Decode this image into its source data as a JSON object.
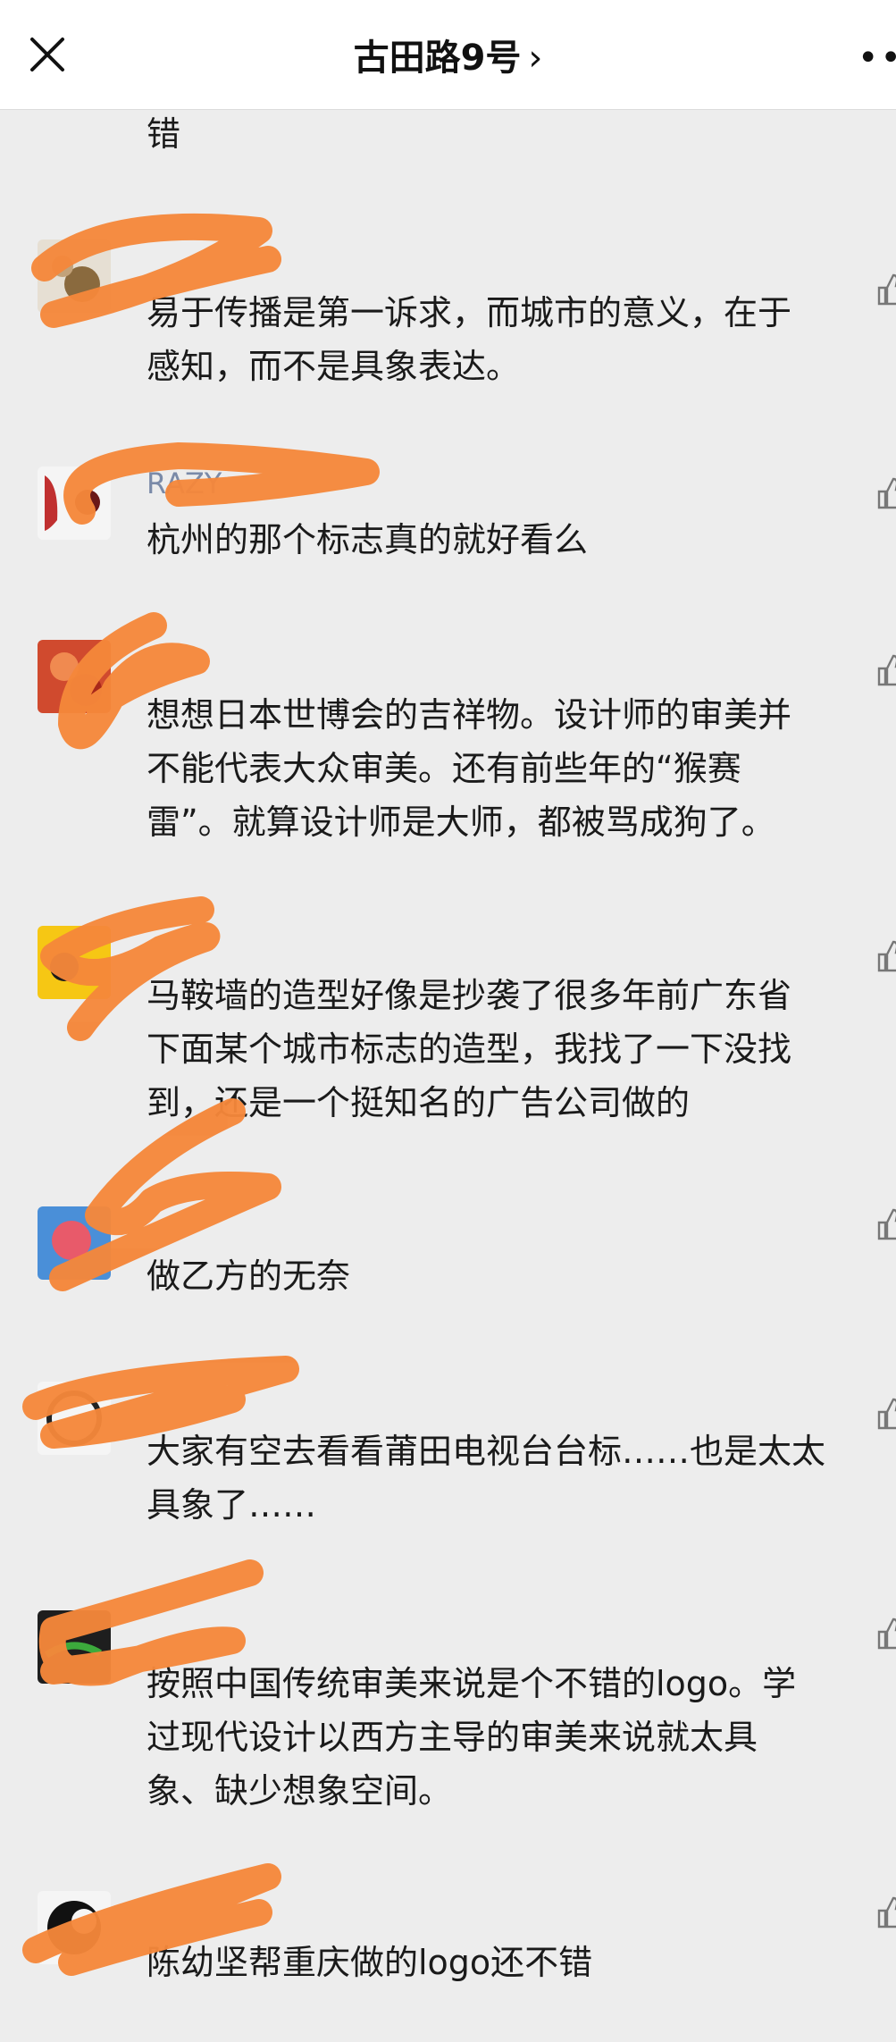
{
  "header": {
    "title": "古田路9号",
    "chevron": "›",
    "more": "••"
  },
  "icons": {
    "close": "close-icon",
    "like": "thumbs-up-icon",
    "more": "more-dots-icon"
  },
  "colors": {
    "redaction": "#f5873a",
    "name_text": "#7a8aa8",
    "background": "#ededed"
  },
  "comments": [
    {
      "name": "",
      "text": "错"
    },
    {
      "name": "",
      "text": "易于传播是第一诉求，而城市的意义，在于\n感知，而不是具象表达。"
    },
    {
      "name": "RAZY",
      "text": "杭州的那个标志真的就好看么"
    },
    {
      "name": "",
      "text": "想想日本世博会的吉祥物。设计师的审美并\n不能代表大众审美。还有前些年的“猴赛\n雷”。就算设计师是大师，都被骂成狗了。"
    },
    {
      "name": "",
      "text": "马鞍墙的造型好像是抄袭了很多年前广东省\n下面某个城市标志的造型，我找了一下没找\n到，还是一个挺知名的广告公司做的"
    },
    {
      "name": "",
      "text": "做乙方的无奈"
    },
    {
      "name": "",
      "text": "大家有空去看看莆田电视台台标……也是太太\n具象了……"
    },
    {
      "name": "",
      "text": "按照中国传统审美来说是个不错的logo。学\n过现代设计以西方主导的审美来说就太具\n象、缺少想象空间。"
    },
    {
      "name": "",
      "text": "陈幼坚帮重庆做的logo还不错"
    }
  ]
}
